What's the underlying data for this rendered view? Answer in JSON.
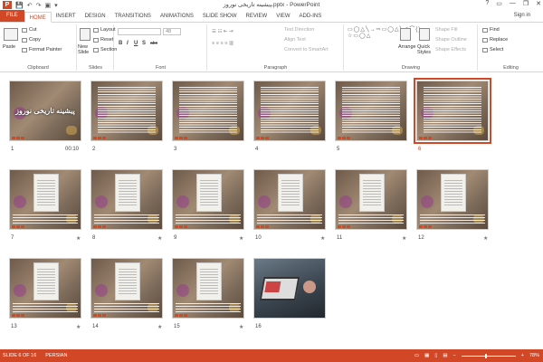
{
  "window": {
    "title": "ﭙیشینه تاریخی نوروز.pptx - PowerPoint",
    "controls": [
      "?",
      "▭",
      "—",
      "❐",
      "✕"
    ]
  },
  "quick_access": [
    "💾",
    "↶",
    "↷",
    "▣",
    "▾"
  ],
  "ribbon": {
    "tabs": [
      "FILE",
      "HOME",
      "INSERT",
      "DESIGN",
      "TRANSITIONS",
      "ANIMATIONS",
      "SLIDE SHOW",
      "REVIEW",
      "VIEW",
      "ADD-INS"
    ],
    "active_tab": "HOME",
    "sign_in": "Sign in",
    "clipboard": {
      "label": "Clipboard",
      "paste": "Paste",
      "cut": "Cut",
      "copy": "Copy",
      "format_painter": "Format Painter"
    },
    "slides": {
      "label": "Slides",
      "new_slide": "New Slide",
      "layout": "Layout",
      "reset": "Reset",
      "section": "Section"
    },
    "font": {
      "label": "Font",
      "size": "48",
      "bold": "B",
      "italic": "I",
      "underline": "U",
      "shadow": "S",
      "strike": "abc"
    },
    "paragraph": {
      "label": "Paragraph",
      "text_direction": "Text Direction",
      "align_text": "Align Text",
      "convert": "Convert to SmartArt"
    },
    "drawing": {
      "label": "Drawing",
      "arrange": "Arrange",
      "quick_styles": "Quick Styles",
      "shape_fill": "Shape Fill",
      "shape_outline": "Shape Outline",
      "shape_effects": "Shape Effects"
    },
    "editing": {
      "label": "Editing",
      "find": "Find",
      "replace": "Replace",
      "select": "Select"
    }
  },
  "slides": [
    {
      "number": "1",
      "time": "00:10",
      "star": "",
      "title": "ﭘیشینه تاریخی نوروز"
    },
    {
      "number": "2",
      "time": "",
      "star": ""
    },
    {
      "number": "3",
      "time": "",
      "star": ""
    },
    {
      "number": "4",
      "time": "",
      "star": ""
    },
    {
      "number": "5",
      "time": "",
      "star": ""
    },
    {
      "number": "6",
      "time": "",
      "star": ""
    },
    {
      "number": "7",
      "time": "",
      "star": "★"
    },
    {
      "number": "8",
      "time": "",
      "star": "★"
    },
    {
      "number": "9",
      "time": "",
      "star": "★"
    },
    {
      "number": "10",
      "time": "",
      "star": "★"
    },
    {
      "number": "11",
      "time": "",
      "star": "★"
    },
    {
      "number": "12",
      "time": "",
      "star": "★"
    },
    {
      "number": "13",
      "time": "",
      "star": "★"
    },
    {
      "number": "14",
      "time": "",
      "star": "★"
    },
    {
      "number": "15",
      "time": "",
      "star": "★"
    },
    {
      "number": "16",
      "time": "",
      "star": ""
    }
  ],
  "selected_slide": "6",
  "status": {
    "slide_info": "SLIDE 6 OF 16",
    "language": "PERSIAN",
    "zoom": "78%"
  },
  "colors": {
    "accent": "#d24726"
  }
}
